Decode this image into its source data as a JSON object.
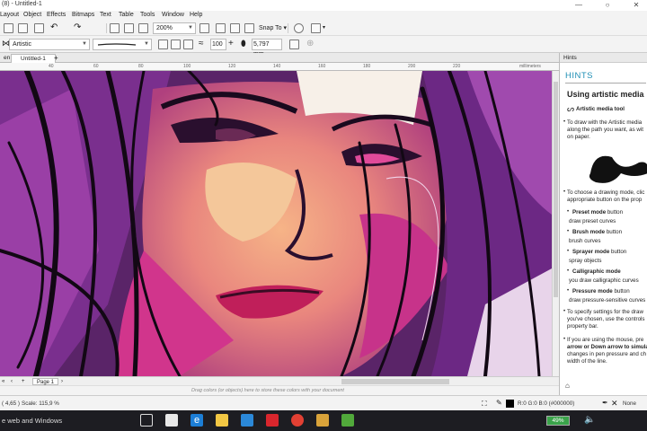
{
  "window": {
    "title": "(8) - Untitled-1"
  },
  "window_controls": {
    "minimize": "—",
    "restore": "○",
    "close": "✕"
  },
  "menu": [
    "Layout",
    "Object",
    "Effects",
    "Bitmaps",
    "Text",
    "Table",
    "Tools",
    "Window",
    "Help"
  ],
  "toolbar": {
    "zoom_level": "200%",
    "snap_to": "Snap To"
  },
  "property_bar": {
    "brush_category": "Artistic",
    "smoothing": "100",
    "width": "5,797 mm"
  },
  "doc_tabs": [
    "en",
    "Untitled-1"
  ],
  "add_tab": "+",
  "ruler": {
    "unit": "millimeters",
    "ticks": [
      "40",
      "60",
      "80",
      "100",
      "120",
      "140",
      "160",
      "180",
      "200",
      "220"
    ]
  },
  "page_nav": {
    "page_label": "Page 1",
    "first": "«",
    "prev": "‹",
    "next": "›",
    "last": "»",
    "add": "+"
  },
  "palette_hint": "Drag colors (or objects) here to store these colors with your document",
  "status": {
    "coords": "( 4,65 )",
    "scale": "Scale: 115,9 %",
    "color_readout": "R:0 G:0 B:0 (#000000)",
    "fill_none": "None"
  },
  "docker": {
    "tab_label": "Hints",
    "section": "HINTS",
    "heading": "Using artistic media",
    "tool_line": "Artistic media tool",
    "para1_line1": "To draw with the Artistic media",
    "para1_line2": "along the path you want, as wit",
    "para1_line3": "on paper.",
    "para2_line1": "To choose a drawing mode, clic",
    "para2_line2": "appropriate button on the prop",
    "modes": [
      {
        "name": "Preset mode",
        "rest": " button",
        "desc": "draw preset curves"
      },
      {
        "name": "Brush mode",
        "rest": " button",
        "desc": "brush curves"
      },
      {
        "name": "Sprayer mode",
        "rest": " button",
        "desc": "spray objects"
      },
      {
        "name": "Calligraphic mode",
        "rest": " button",
        "desc": "you draw calligraphic curves"
      },
      {
        "name": "Pressure mode",
        "rest": " button",
        "desc": "draw pressure-sensitive curves"
      }
    ],
    "para3_line1": "To specify settings for the draw",
    "para3_line2": "you've chosen, use the controls",
    "para3_line3": "property bar.",
    "para4_line1": "If you are using the mouse, pre",
    "para4_line2": "arrow or Down arrow to simula",
    "para4_line3": "changes in pen pressure and ch",
    "para4_line4": "width of the line."
  },
  "taskbar": {
    "search": "e web and Windows",
    "battery": "49%",
    "icons": [
      "task-view-icon",
      "mail-icon",
      "edge-icon",
      "explorer-icon",
      "store-icon",
      "security-icon",
      "chrome-icon",
      "game-icon",
      "coreldraw-icon"
    ]
  },
  "colors": {
    "accent": "#1f8fb5",
    "taskbar": "#1d1d22",
    "canvas_purple": "#7b2a8f",
    "magenta": "#d6338f",
    "skin": "#f2a57a"
  }
}
